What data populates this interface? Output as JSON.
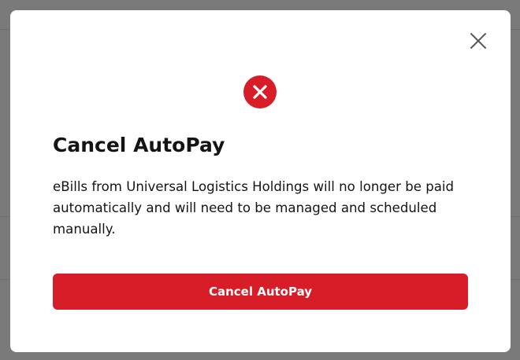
{
  "dialog": {
    "title": "Cancel AutoPay",
    "message": "eBills from Universal Logistics Holdings will no longer be paid automatically and will need to be managed and scheduled manually.",
    "confirm_label": "Cancel AutoPay",
    "close_icon": "close-icon",
    "status_icon": "error-icon"
  },
  "colors": {
    "accent": "#d71e28",
    "text": "#141414",
    "overlay": "#7a7a7a"
  }
}
